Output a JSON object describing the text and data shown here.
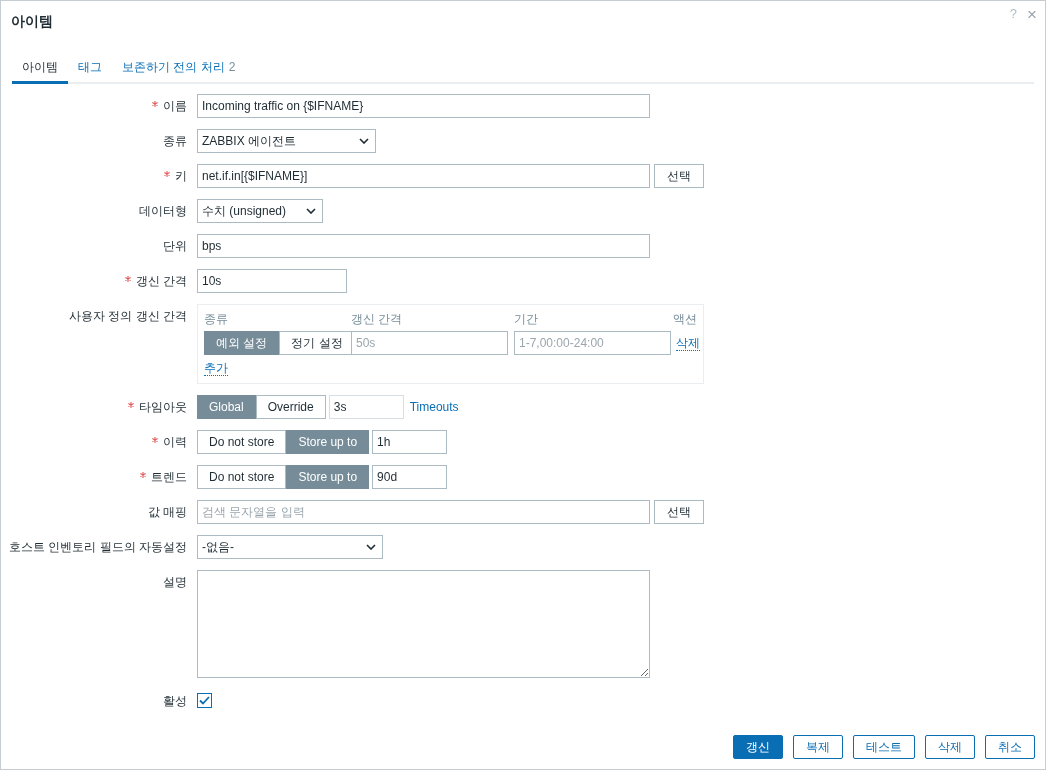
{
  "dialog": {
    "title": "아이템",
    "help": "?",
    "close": "×"
  },
  "tabs": [
    {
      "label": "아이템",
      "selected": true
    },
    {
      "label": "태그",
      "selected": false
    },
    {
      "label": "보존하기 전의 처리",
      "count": "2",
      "selected": false
    }
  ],
  "fields": [
    {
      "kind": "text",
      "label": "이름",
      "required": true,
      "value": "Incoming traffic on {$IFNAME}"
    },
    {
      "kind": "select",
      "label": "종류",
      "required": false,
      "value": "ZABBIX 에이전트"
    },
    {
      "kind": "text_button",
      "label": "키",
      "required": true,
      "value": "net.if.in[{$IFNAME}]",
      "button": "선택"
    },
    {
      "kind": "select",
      "label": "데이터형",
      "required": false,
      "value": "수치 (unsigned)"
    },
    {
      "kind": "text",
      "label": "단위",
      "required": false,
      "value": "bps"
    },
    {
      "kind": "short_text",
      "label": "갱신 간격",
      "required": true,
      "value": "10s"
    },
    {
      "kind": "custom_intervals",
      "label": "사용자 정의 갱신 간격",
      "required": false,
      "headers": [
        "종류",
        "갱신 간격",
        "기간",
        "액션"
      ],
      "rows": [
        {
          "options": [
            {
              "label": "예외 설정",
              "selected": true
            },
            {
              "label": "정기 설정",
              "selected": false
            }
          ],
          "interval_placeholder": "50s",
          "period_placeholder": "1-7,00:00-24:00",
          "action": "삭제"
        }
      ],
      "add": "추가"
    },
    {
      "kind": "segmented_readonly",
      "label": "타임아웃",
      "required": true,
      "options": [
        {
          "label": "Global",
          "selected": true
        },
        {
          "label": "Override",
          "selected": false
        }
      ],
      "value": "3s",
      "link": "Timeouts"
    },
    {
      "kind": "segmented_input",
      "label": "이력",
      "required": true,
      "options": [
        {
          "label": "Do not store",
          "selected": false
        },
        {
          "label": "Store up to",
          "selected": true
        }
      ],
      "value": "1h"
    },
    {
      "kind": "segmented_input",
      "label": "트렌드",
      "required": true,
      "options": [
        {
          "label": "Do not store",
          "selected": false
        },
        {
          "label": "Store up to",
          "selected": true
        }
      ],
      "value": "90d"
    },
    {
      "kind": "text_button",
      "label": "값 매핑",
      "required": false,
      "placeholder": "검색 문자열을 입력",
      "button": "선택"
    },
    {
      "kind": "select",
      "label": "호스트 인벤토리 필드의 자동설정",
      "required": false,
      "value": "-없음-"
    },
    {
      "kind": "textarea",
      "label": "설명",
      "required": false
    },
    {
      "kind": "checkbox",
      "label": "활성",
      "required": false,
      "checked": true
    }
  ],
  "buttons": [
    {
      "label": "갱신",
      "kind": "primary"
    },
    {
      "label": "복제",
      "kind": "secondary"
    },
    {
      "label": "테스트",
      "kind": "secondary"
    },
    {
      "label": "삭제",
      "kind": "secondary"
    },
    {
      "label": "취소",
      "kind": "secondary"
    }
  ]
}
